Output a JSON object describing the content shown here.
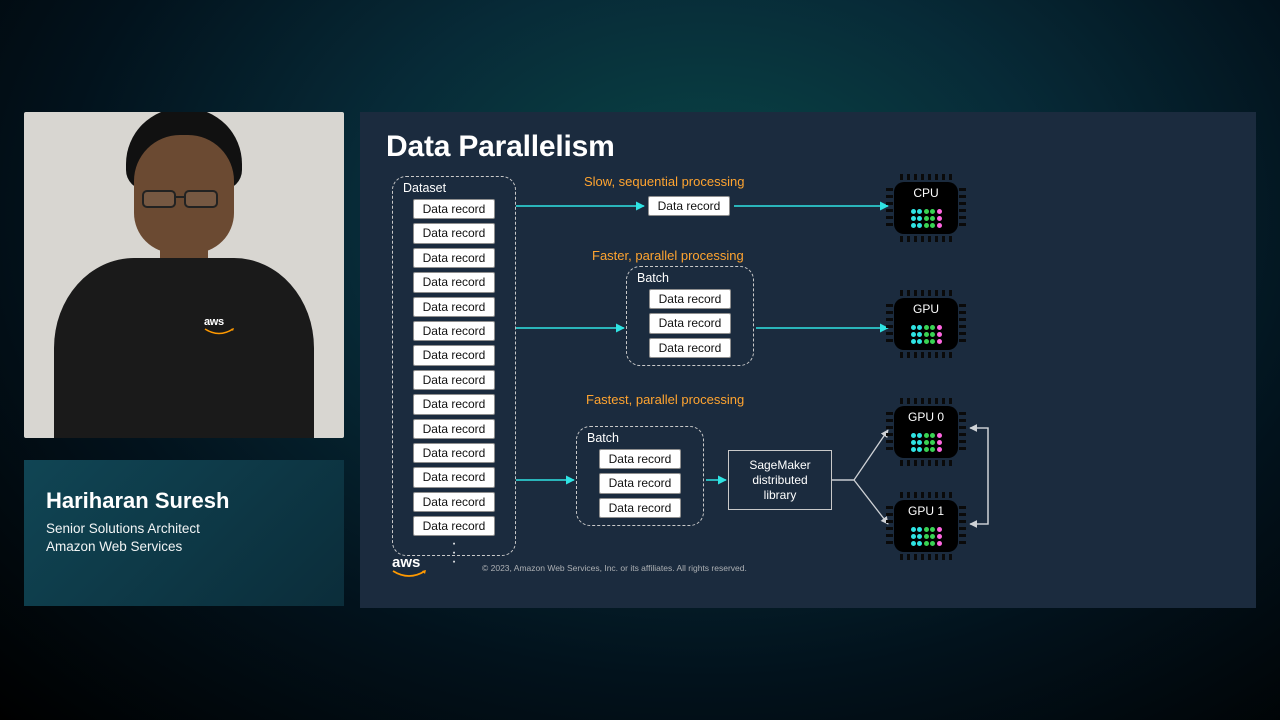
{
  "speaker": {
    "name": "Hariharan Suresh",
    "title": "Senior Solutions Architect",
    "org": "Amazon Web Services",
    "shirt_brand": "aws"
  },
  "slide": {
    "title": "Data Parallelism",
    "dataset_label": "Dataset",
    "batch_label": "Batch",
    "record_label": "Data record",
    "dataset_records_count": 14,
    "row1": {
      "caption": "Slow, sequential processing",
      "chip_label": "CPU"
    },
    "row2": {
      "caption": "Faster, parallel processing",
      "chip_label": "GPU",
      "batch_n": 3
    },
    "row3": {
      "caption": "Fastest, parallel processing",
      "chip0_label": "GPU 0",
      "chip1_label": "GPU 1",
      "batch_n": 3,
      "sm_lines": [
        "SageMaker",
        "distributed",
        "library"
      ]
    },
    "footer": {
      "brand": "aws",
      "copyright": "© 2023, Amazon Web Services, Inc. or its affiliates. All rights reserved."
    }
  }
}
